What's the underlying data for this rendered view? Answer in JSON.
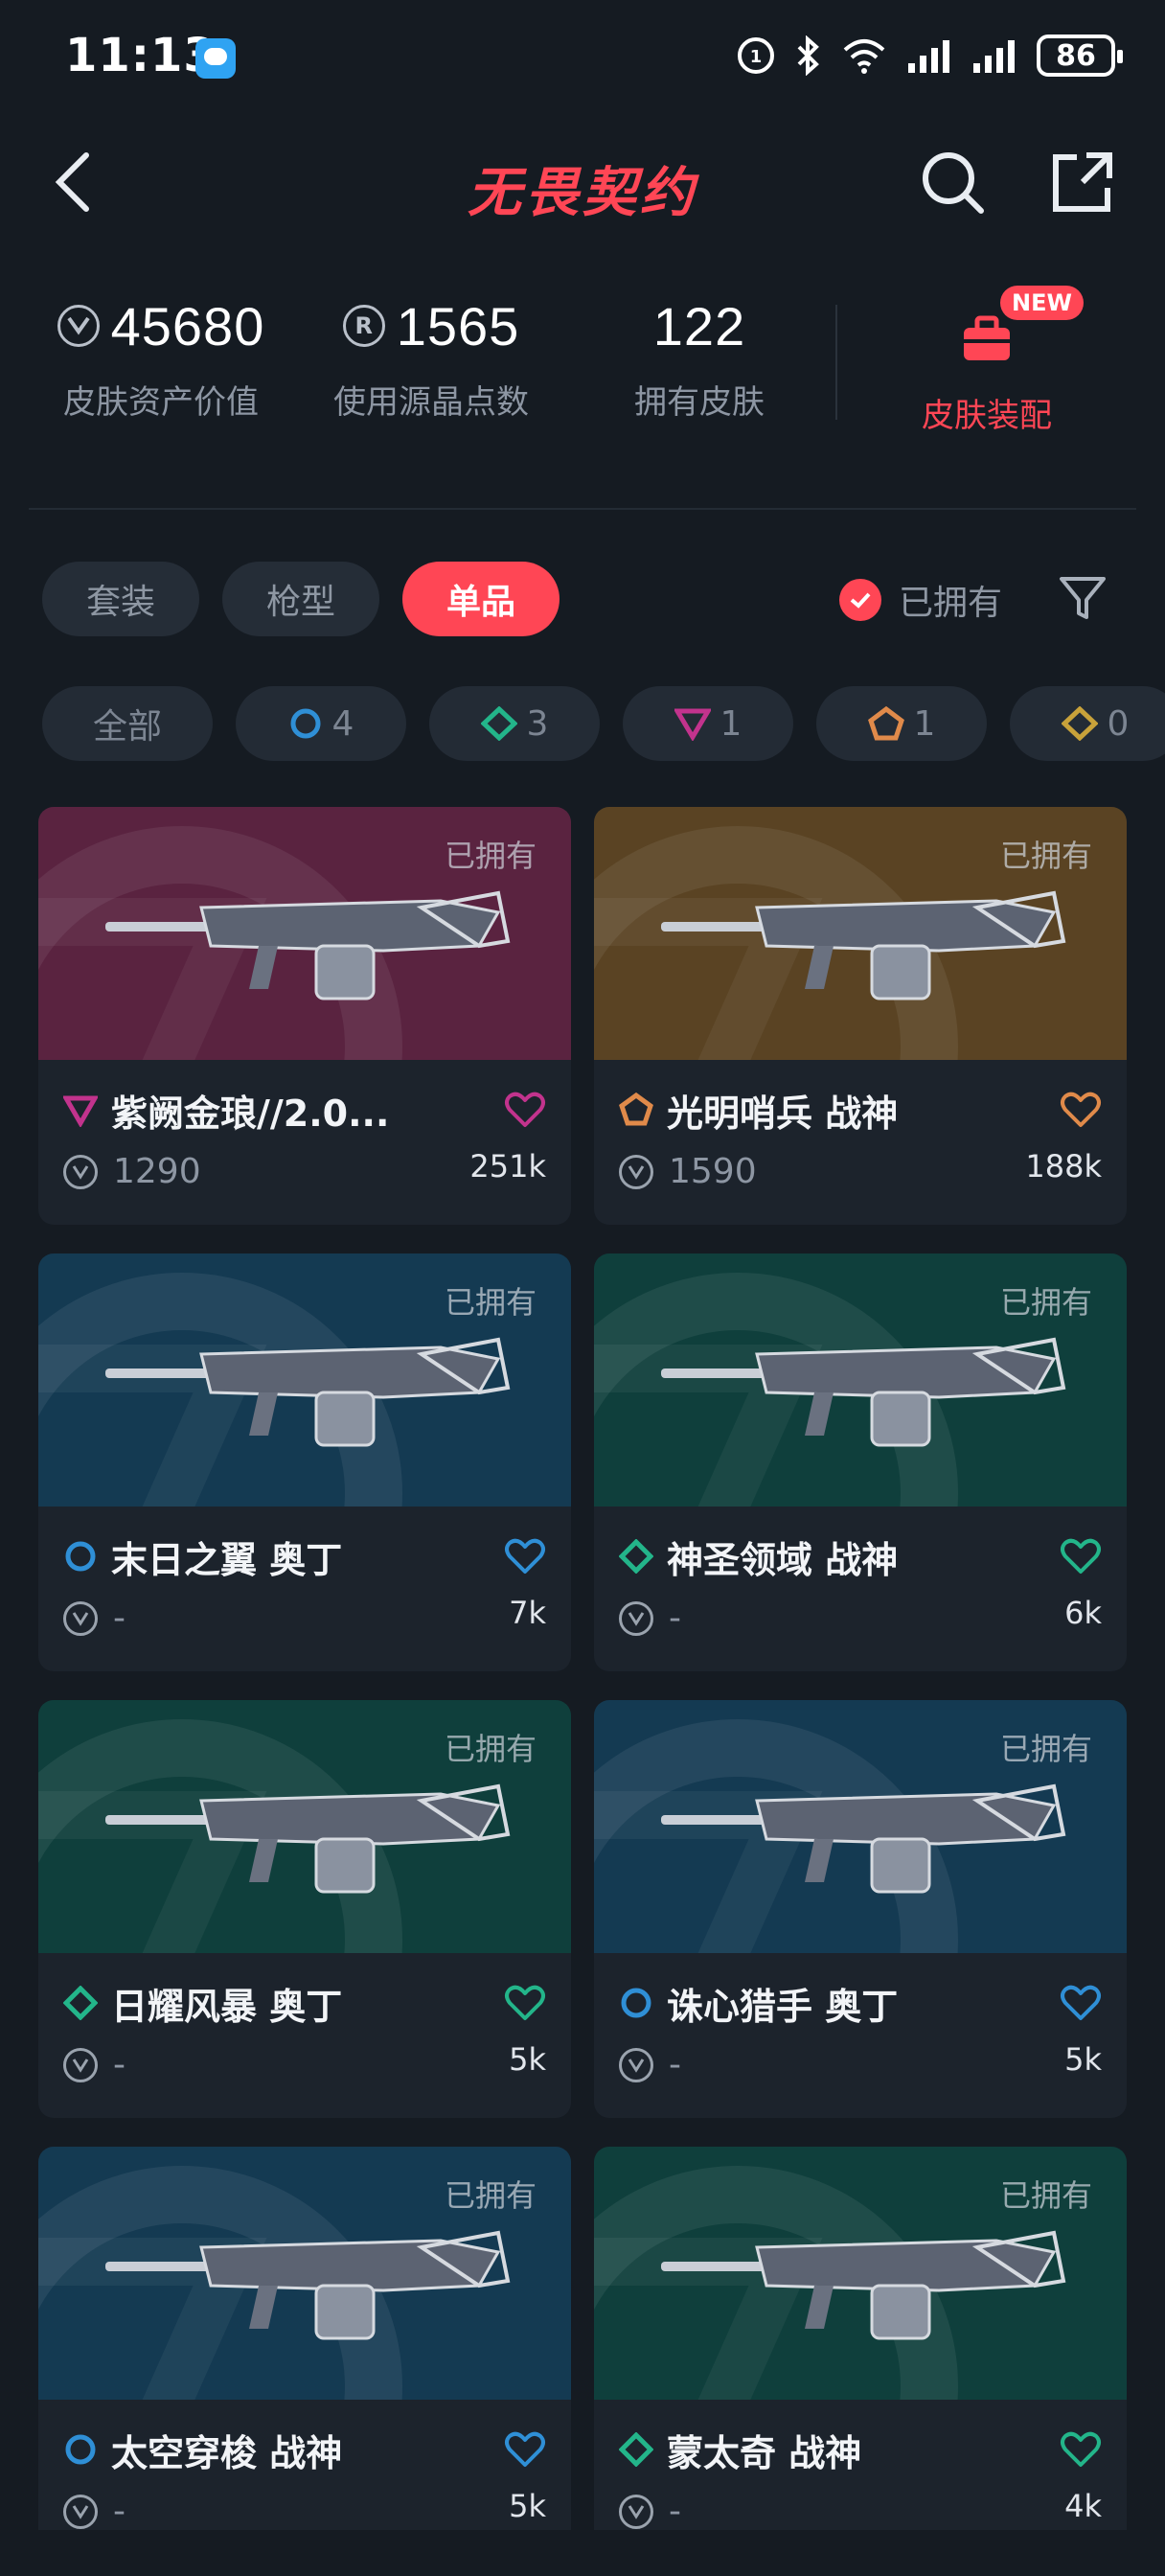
{
  "status_bar": {
    "time": "11:13",
    "battery": "86"
  },
  "header": {
    "title": "无畏契约"
  },
  "stats": [
    {
      "value": "45680",
      "label": "皮肤资产价值",
      "icon": "vp-icon"
    },
    {
      "value": "1565",
      "label": "使用源晶点数",
      "icon": "radianite-icon"
    },
    {
      "value": "122",
      "label": "拥有皮肤",
      "icon": ""
    }
  ],
  "outfit": {
    "label": "皮肤装配",
    "badge": "NEW",
    "icon": "briefcase-icon"
  },
  "tabs": [
    {
      "label": "套装",
      "active": false
    },
    {
      "label": "枪型",
      "active": false
    },
    {
      "label": "单品",
      "active": true
    }
  ],
  "owned_filter": {
    "label": "已拥有",
    "checked": true
  },
  "chips": [
    {
      "label": "全部"
    },
    {
      "count": "4",
      "tier": "premium",
      "color": "#2f8fd6"
    },
    {
      "count": "3",
      "tier": "deluxe",
      "color": "#23b58a"
    },
    {
      "count": "1",
      "tier": "exclusive",
      "color": "#c2338d"
    },
    {
      "count": "1",
      "tier": "ultra",
      "color": "#e08a4a"
    },
    {
      "count": "0",
      "tier": "select",
      "color": "#c8a23a"
    }
  ],
  "cards": [
    {
      "name": "紫阙金琅//2.0...",
      "price": "1290",
      "likes": "251k",
      "owned": "已拥有",
      "tier_color": "#c2338d",
      "tier_icon": "triangle-tier-icon",
      "heart_color": "#c2338d",
      "bg": "#5a2340"
    },
    {
      "name": "光明哨兵 战神",
      "price": "1590",
      "likes": "188k",
      "owned": "已拥有",
      "tier_color": "#e08a4a",
      "tier_icon": "pentagon-tier-icon",
      "heart_color": "#e08a4a",
      "bg": "#5a4323"
    },
    {
      "name": "末日之翼 奥丁",
      "price": "-",
      "likes": "7k",
      "owned": "已拥有",
      "tier_color": "#2f8fd6",
      "tier_icon": "circle-tier-icon",
      "heart_color": "#2f8fd6",
      "bg": "#143a52"
    },
    {
      "name": "神圣领域 战神",
      "price": "-",
      "likes": "6k",
      "owned": "已拥有",
      "tier_color": "#23b58a",
      "tier_icon": "diamond-tier-icon",
      "heart_color": "#23b58a",
      "bg": "#0f3f3c"
    },
    {
      "name": "日耀风暴 奥丁",
      "price": "-",
      "likes": "5k",
      "owned": "已拥有",
      "tier_color": "#23b58a",
      "tier_icon": "diamond-tier-icon",
      "heart_color": "#23b58a",
      "bg": "#0f3f3c"
    },
    {
      "name": "诛心猎手 奥丁",
      "price": "-",
      "likes": "5k",
      "owned": "已拥有",
      "tier_color": "#2f8fd6",
      "tier_icon": "circle-tier-icon",
      "heart_color": "#2f8fd6",
      "bg": "#143a52"
    },
    {
      "name": "太空穿梭 战神",
      "price": "-",
      "likes": "5k",
      "owned": "已拥有",
      "tier_color": "#2f8fd6",
      "tier_icon": "circle-tier-icon",
      "heart_color": "#2f8fd6",
      "bg": "#143a52"
    },
    {
      "name": "蒙太奇 战神",
      "price": "-",
      "likes": "4k",
      "owned": "已拥有",
      "tier_color": "#23b58a",
      "tier_icon": "diamond-tier-icon",
      "heart_color": "#23b58a",
      "bg": "#0f3f3c"
    }
  ]
}
